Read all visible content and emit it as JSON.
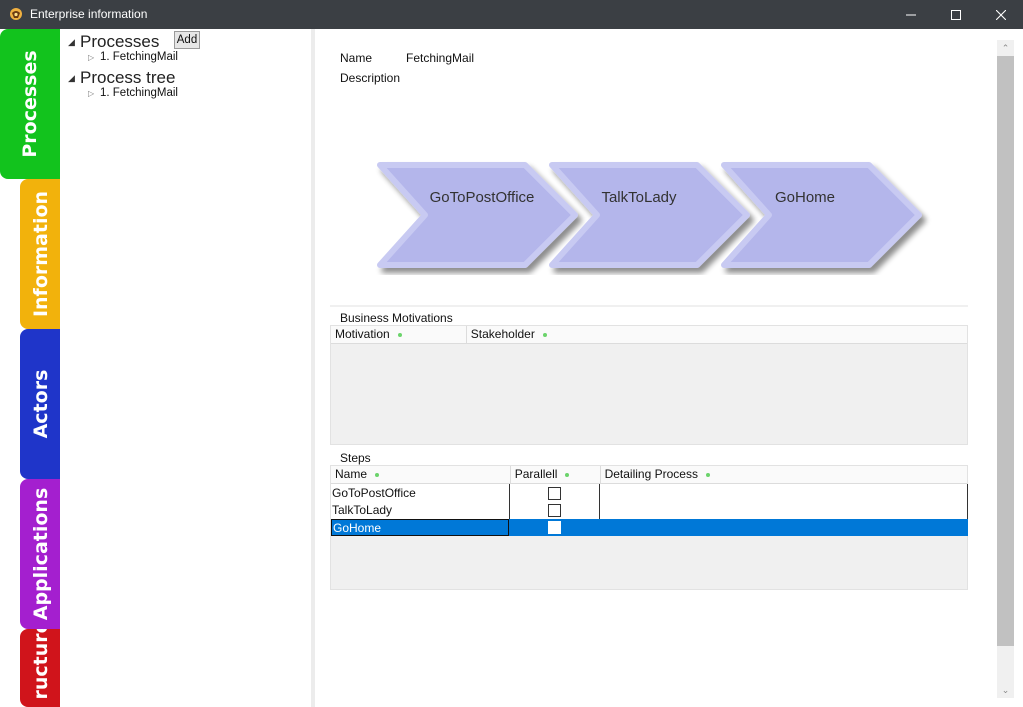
{
  "window": {
    "title": "Enterprise information",
    "icon": "app-icon"
  },
  "side_tabs": [
    {
      "label": "Processes",
      "color": "#12c31d"
    },
    {
      "label": "Information",
      "color": "#f2b20c"
    },
    {
      "label": "Actors",
      "color": "#1f35c9"
    },
    {
      "label": "Applications",
      "color": "#a41fcf"
    },
    {
      "label": "ructure",
      "color": "#d0141b"
    }
  ],
  "tree": {
    "processes_label": "Processes",
    "add_label": "Add",
    "process_item": "1. FetchingMail",
    "process_tree_label": "Process tree",
    "process_tree_item": "1. FetchingMail"
  },
  "detail": {
    "name_label": "Name",
    "name_value": "FetchingMail",
    "description_label": "Description"
  },
  "diagram": {
    "steps": [
      "GoToPostOffice",
      "TalkToLady",
      "GoHome"
    ],
    "fill": "#b4b6eb",
    "border": "#c8caf2"
  },
  "business_motivations": {
    "title": "Business Motivations",
    "columns": [
      "Motivation",
      "Stakeholder"
    ]
  },
  "steps": {
    "title": "Steps",
    "columns": [
      "Name",
      "Parallell",
      "Detailing Process"
    ],
    "rows": [
      {
        "name": "GoToPostOffice",
        "parallel": false,
        "detailing": ""
      },
      {
        "name": "TalkToLady",
        "parallel": false,
        "detailing": ""
      },
      {
        "name": "GoHome",
        "parallel": false,
        "detailing": "",
        "selected": true
      }
    ],
    "selection_color": "#0078d7"
  }
}
